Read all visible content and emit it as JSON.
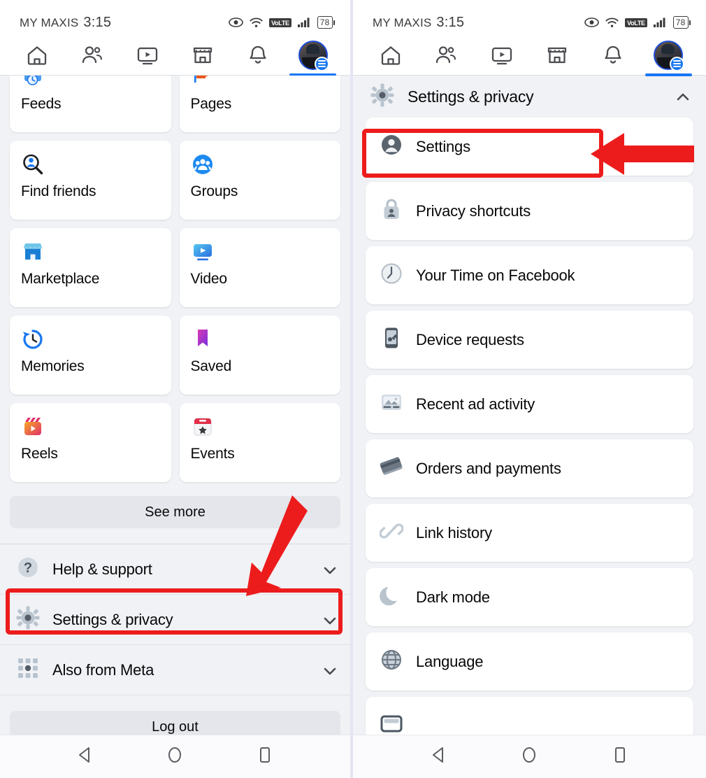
{
  "status_bar": {
    "carrier": "MY MAXIS",
    "time": "3:15",
    "icons": [
      "eye-icon",
      "wifi-icon",
      "volte-icon",
      "signal-bars-icon",
      "battery-icon"
    ],
    "volte_label": "VoLTE",
    "battery_level": "78"
  },
  "tab_bar": {
    "tabs": [
      {
        "name": "home",
        "icon": "home-icon",
        "active": false
      },
      {
        "name": "friends",
        "icon": "friends-icon",
        "active": false
      },
      {
        "name": "video",
        "icon": "video-icon",
        "active": false
      },
      {
        "name": "marketplace",
        "icon": "marketplace-icon",
        "active": false
      },
      {
        "name": "notifications",
        "icon": "bell-icon",
        "active": false
      },
      {
        "name": "menu",
        "icon": "avatar-icon",
        "active": true
      }
    ]
  },
  "left_panel": {
    "shortcuts": [
      {
        "label": "Feeds",
        "icon": "feeds-icon"
      },
      {
        "label": "Pages",
        "icon": "pages-flag-icon"
      },
      {
        "label": "Find friends",
        "icon": "find-friends-icon"
      },
      {
        "label": "Groups",
        "icon": "groups-icon"
      },
      {
        "label": "Marketplace",
        "icon": "marketplace-store-icon"
      },
      {
        "label": "Video",
        "icon": "video-play-icon"
      },
      {
        "label": "Memories",
        "icon": "memories-clock-icon"
      },
      {
        "label": "Saved",
        "icon": "saved-bookmark-icon"
      },
      {
        "label": "Reels",
        "icon": "reels-icon"
      },
      {
        "label": "Events",
        "icon": "events-calendar-icon"
      }
    ],
    "see_more_label": "See more",
    "menu_rows": [
      {
        "label": "Help & support",
        "icon": "help-question-icon",
        "chevron": "chevron-down-icon",
        "highlighted": false
      },
      {
        "label": "Settings & privacy",
        "icon": "gear-icon",
        "chevron": "chevron-down-icon",
        "highlighted": true
      },
      {
        "label": "Also from Meta",
        "icon": "meta-apps-grid-icon",
        "chevron": "chevron-down-icon",
        "highlighted": false
      }
    ],
    "log_out_label": "Log out"
  },
  "right_panel": {
    "header": {
      "title": "Settings & privacy",
      "icon": "gear-icon",
      "chevron": "chevron-up-icon"
    },
    "items": [
      {
        "label": "Settings",
        "icon": "account-circle-icon",
        "highlighted": true
      },
      {
        "label": "Privacy shortcuts",
        "icon": "lock-person-icon",
        "highlighted": false
      },
      {
        "label": "Your Time on Facebook",
        "icon": "clock-icon",
        "highlighted": false
      },
      {
        "label": "Device requests",
        "icon": "device-phone-icon",
        "highlighted": false
      },
      {
        "label": "Recent ad activity",
        "icon": "ad-image-icon",
        "highlighted": false
      },
      {
        "label": "Orders and payments",
        "icon": "card-stack-icon",
        "highlighted": false
      },
      {
        "label": "Link history",
        "icon": "link-chain-icon",
        "highlighted": false
      },
      {
        "label": "Dark mode",
        "icon": "moon-icon",
        "highlighted": false
      },
      {
        "label": "Language",
        "icon": "globe-icon",
        "highlighted": false
      },
      {
        "label": "",
        "icon": "cellular-data-icon",
        "highlighted": false
      }
    ]
  },
  "nav_bar": {
    "buttons": [
      {
        "name": "back",
        "icon": "back-triangle-icon"
      },
      {
        "name": "home",
        "icon": "home-circle-icon"
      },
      {
        "name": "recents",
        "icon": "recents-square-icon"
      }
    ]
  },
  "annotations": {
    "color": "#ED1C1C",
    "left_arrow_target": "Settings & privacy",
    "right_arrow_target": "Settings",
    "boxes": [
      "settings-and-privacy-row",
      "settings-item"
    ]
  }
}
